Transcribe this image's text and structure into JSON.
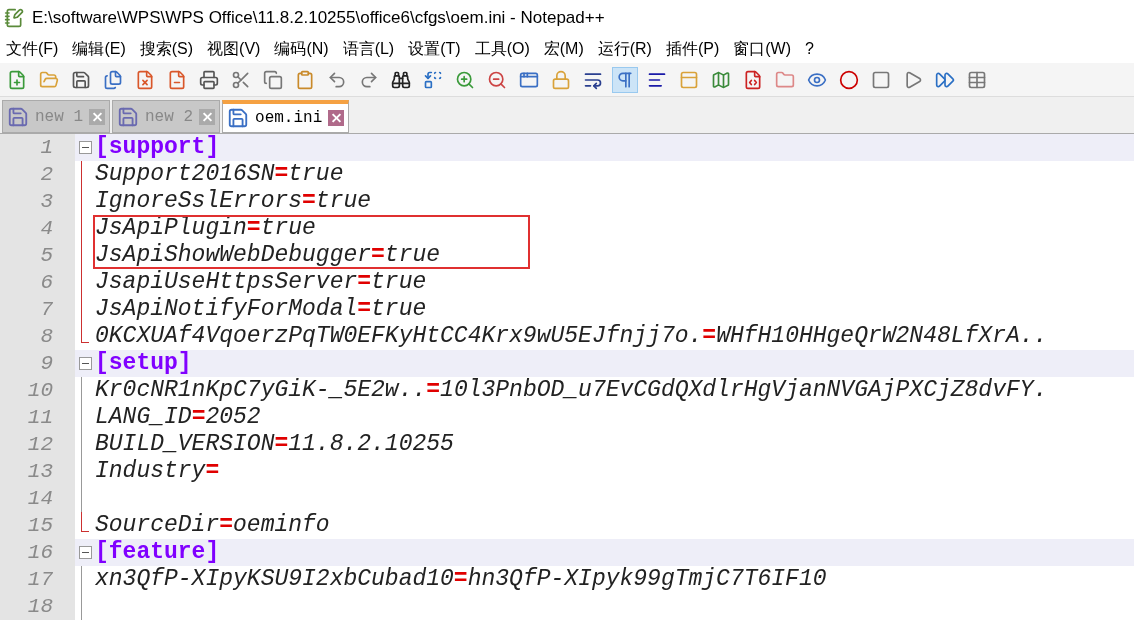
{
  "window": {
    "title": "E:\\software\\WPS\\WPS Office\\11.8.2.10255\\office6\\cfgs\\oem.ini - Notepad++"
  },
  "menu": [
    "文件(F)",
    "编辑(E)",
    "搜索(S)",
    "视图(V)",
    "编码(N)",
    "语言(L)",
    "设置(T)",
    "工具(O)",
    "宏(M)",
    "运行(R)",
    "插件(P)",
    "窗口(W)",
    "?"
  ],
  "toolbar": [
    {
      "selected": false
    },
    {
      "selected": false
    },
    {
      "selected": false
    },
    {
      "selected": false
    },
    {
      "selected": false
    },
    {
      "selected": false
    },
    {
      "selected": false
    },
    {
      "selected": false
    },
    {
      "selected": false
    },
    {
      "selected": false
    },
    {
      "selected": false
    },
    {
      "selected": false
    },
    {
      "selected": false
    },
    {
      "selected": false
    },
    {
      "selected": false
    },
    {
      "selected": false
    },
    {
      "selected": false
    },
    {
      "selected": false
    },
    {
      "selected": false
    },
    {
      "selected": true
    },
    {
      "selected": false
    },
    {
      "selected": false
    },
    {
      "selected": false
    },
    {
      "selected": false
    },
    {
      "selected": false
    },
    {
      "selected": false
    },
    {
      "selected": false
    },
    {
      "selected": false
    },
    {
      "selected": false
    },
    {
      "selected": false
    },
    {
      "selected": false
    }
  ],
  "tabs": [
    {
      "label": "new 1",
      "selected": false
    },
    {
      "label": "new 2",
      "selected": false
    },
    {
      "label": "oem.ini",
      "selected": true
    }
  ],
  "lines": [
    {
      "number": "1",
      "kind": "section",
      "name": "[support]",
      "boxed": false,
      "fold_end": false
    },
    {
      "number": "2",
      "kind": "pair",
      "key": "Support2016SN",
      "sep": "=",
      "value": "true",
      "boxed": false,
      "fold_end": false
    },
    {
      "number": "3",
      "kind": "pair",
      "key": "IgnoreSslErrors",
      "sep": "=",
      "value": "true",
      "boxed": false,
      "fold_end": false
    },
    {
      "number": "4",
      "kind": "pair",
      "key": "JsApiPlugin",
      "sep": "=",
      "value": "true",
      "boxed": true,
      "fold_end": false
    },
    {
      "number": "5",
      "kind": "pair",
      "key": "JsApiShowWebDebugger",
      "sep": "=",
      "value": "true",
      "boxed": true,
      "fold_end": false
    },
    {
      "number": "6",
      "kind": "pair",
      "key": "JsapiUseHttpsServer",
      "sep": "=",
      "value": "true",
      "boxed": false,
      "fold_end": false
    },
    {
      "number": "7",
      "kind": "pair",
      "key": "JsApiNotifyForModal",
      "sep": "=",
      "value": "true",
      "boxed": false,
      "fold_end": false
    },
    {
      "number": "8",
      "kind": "pair",
      "key": "0KCXUAf4VqoerzPqTW0EFKyHtCC4Krx9wU5EJfnjj7o.",
      "sep": "=",
      "value": "WHfH10HHgeQrW2N48LfXrA..",
      "boxed": false,
      "fold_end": true
    },
    {
      "number": "9",
      "kind": "section",
      "name": "[setup]",
      "boxed": false,
      "fold_end": false
    },
    {
      "number": "10",
      "kind": "pair",
      "key": "Kr0cNR1nKpC7yGiK-_5E2w..",
      "sep": "=",
      "value": "10l3PnbOD_u7EvCGdQXdlrHgVjanNVGAjPXCjZ8dvFY.",
      "boxed": false,
      "fold_end": false
    },
    {
      "number": "11",
      "kind": "pair",
      "key": "LANG_ID",
      "sep": "=",
      "value": "2052",
      "boxed": false,
      "fold_end": false
    },
    {
      "number": "12",
      "kind": "pair",
      "key": "BUILD_VERSION",
      "sep": "=",
      "value": "11.8.2.10255",
      "boxed": false,
      "fold_end": false
    },
    {
      "number": "13",
      "kind": "pair",
      "key": "Industry",
      "sep": "=",
      "boxed": false,
      "fold_end": false
    },
    {
      "number": "14",
      "kind": "blank",
      "boxed": false,
      "fold_end": false
    },
    {
      "number": "15",
      "kind": "pair",
      "key": "SourceDir",
      "sep": "=",
      "value": "oeminfo",
      "boxed": false,
      "fold_end": true
    },
    {
      "number": "16",
      "kind": "section",
      "name": "[feature]",
      "boxed": false,
      "fold_end": false
    },
    {
      "number": "17",
      "kind": "pair",
      "key": "xn3QfP-XIpyKSU9I2xbCubad10",
      "sep": "=",
      "value": "hn3QfP-XIpyk99gTmjC7T6IF10",
      "boxed": false,
      "fold_end": false
    },
    {
      "number": "18",
      "kind": "blank",
      "boxed": false,
      "fold_end": false
    }
  ]
}
